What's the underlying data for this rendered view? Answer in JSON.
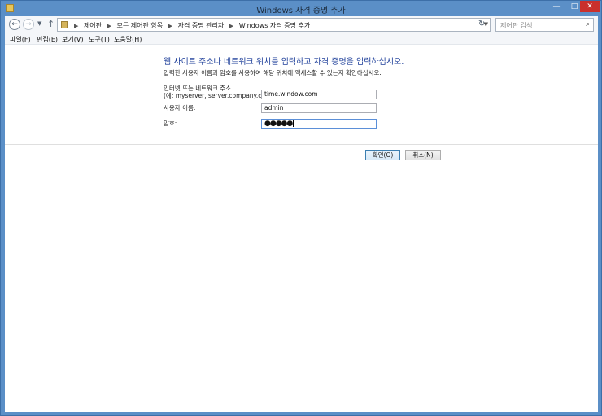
{
  "window": {
    "title": "Windows 자격 증명 추가"
  },
  "caption_buttons": {
    "minimize": "—",
    "maximize": "□",
    "close": "✕"
  },
  "address_bar": {
    "crumbs": [
      "제어판",
      "모든 제어판 항목",
      "자격 증명 관리자",
      "Windows 자격 증명 추가"
    ],
    "search_placeholder": "제어판 검색"
  },
  "menu": [
    "파일(F)",
    "편집(E)",
    "보기(V)",
    "도구(T)",
    "도움말(H)"
  ],
  "form": {
    "heading": "웹 사이트 주소나 네트워크 위치를 입력하고 자격 증명을 입력하십시오.",
    "subtext": "입력한 사용자 이름과 암호를 사용하여 해당 위치에 액세스할 수 있는지 확인하십시오.",
    "address_label_line1": "인터넷 또는 네트워크 주소",
    "address_label_line2": "(예: myserver, server.company.com):",
    "address_value": "time.window.com",
    "user_label": "사용자 이름:",
    "user_value": "admin",
    "password_label": "암호:",
    "password_mask": "●●●●●"
  },
  "buttons": {
    "ok": "확인(O)",
    "cancel": "취소(N)"
  }
}
